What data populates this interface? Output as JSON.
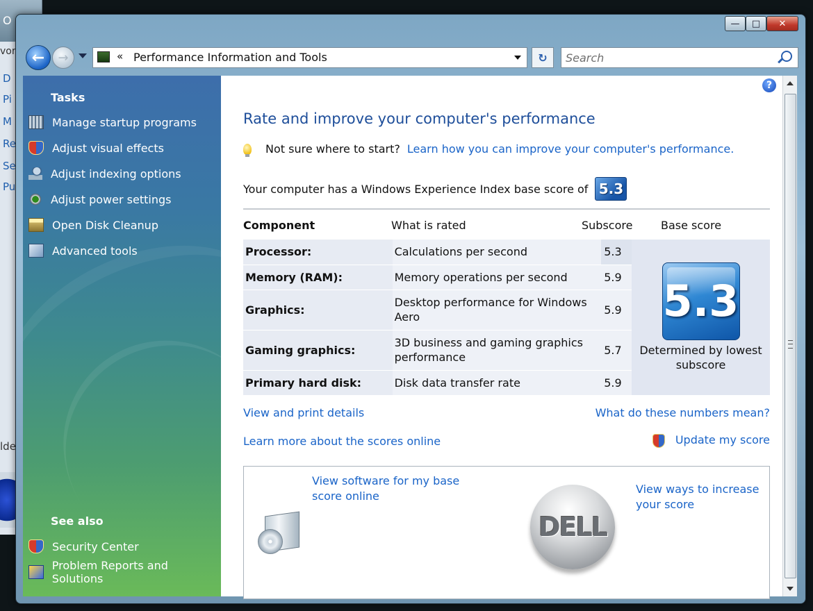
{
  "background_window": {
    "title_fragment": "O",
    "items": [
      "D",
      "Pi",
      "M",
      "Re",
      "Se",
      "Pu"
    ],
    "partial_labels": [
      "vor",
      "lde"
    ]
  },
  "window": {
    "buttons": {
      "minimize": "—",
      "maximize": "□",
      "close": "✕"
    }
  },
  "nav": {
    "back_glyph": "←",
    "forward_glyph": "→",
    "breadcrumb_chevron": "«",
    "address": "Performance Information and Tools",
    "refresh_glyph": "↻",
    "search_placeholder": "Search"
  },
  "sidebar": {
    "tasks_heading": "Tasks",
    "tasks": [
      {
        "label": "Manage startup programs",
        "icon": "startup-programs-icon"
      },
      {
        "label": "Adjust visual effects",
        "icon": "shield-icon"
      },
      {
        "label": "Adjust indexing options",
        "icon": "indexing-icon"
      },
      {
        "label": "Adjust power settings",
        "icon": "power-icon"
      },
      {
        "label": "Open Disk Cleanup",
        "icon": "disk-cleanup-icon"
      },
      {
        "label": "Advanced tools",
        "icon": "advanced-tools-icon"
      }
    ],
    "see_also_heading": "See also",
    "see_also": [
      {
        "label": "Security Center",
        "icon": "shield-icon"
      },
      {
        "label": "Problem Reports and Solutions",
        "icon": "problem-reports-icon"
      }
    ]
  },
  "main": {
    "help_glyph": "?",
    "title": "Rate and improve your computer's performance",
    "hint_text": "Not sure where to start?",
    "hint_link": "Learn how you can improve your computer's performance.",
    "wei_text": "Your computer has a Windows Experience Index base score of",
    "base_score": "5.3",
    "table_headers": {
      "component": "Component",
      "what": "What is rated",
      "subscore": "Subscore",
      "base": "Base score"
    },
    "rows": [
      {
        "component": "Processor:",
        "what": "Calculations per second",
        "subscore": "5.3"
      },
      {
        "component": "Memory (RAM):",
        "what": "Memory operations per second",
        "subscore": "5.9"
      },
      {
        "component": "Graphics:",
        "what": "Desktop performance for Windows Aero",
        "subscore": "5.9"
      },
      {
        "component": "Gaming graphics:",
        "what": "3D business and gaming graphics performance",
        "subscore": "5.7"
      },
      {
        "component": "Primary hard disk:",
        "what": "Disk data transfer rate",
        "subscore": "5.9"
      }
    ],
    "base_caption": "Determined by lowest subscore",
    "links": {
      "view_print": "View and print details",
      "what_numbers": "What do these numbers mean?",
      "learn_more": "Learn more about the scores online",
      "update_score": "Update my score"
    },
    "box": {
      "software_link": "View software for my base score online",
      "increase_link": "View ways to increase your score",
      "logo_text": "DELL"
    }
  }
}
